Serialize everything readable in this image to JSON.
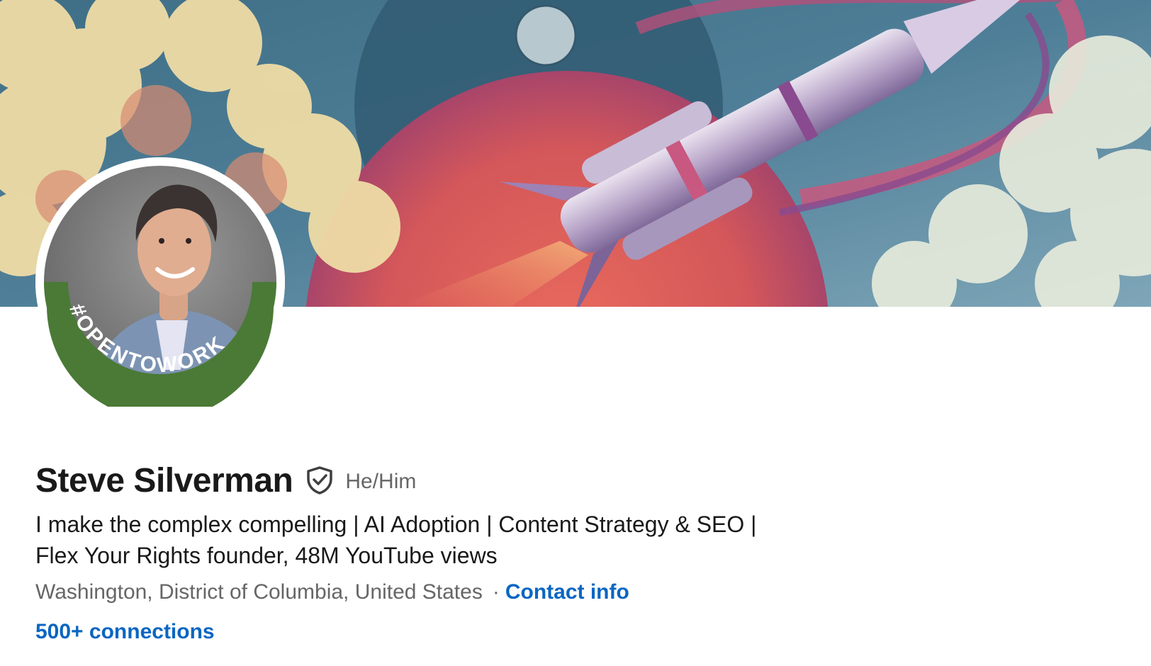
{
  "profile": {
    "name": "Steve Silverman",
    "pronouns": "He/Him",
    "headline": "I make the complex compelling | AI Adoption | Content Strategy & SEO | Flex Your Rights founder, 48M YouTube views",
    "location": "Washington, District of Columbia, United States",
    "separator": "·",
    "contact_info_label": "Contact info",
    "connections_label": "500+ connections",
    "open_to_work_label": "#OPENTOWORK"
  },
  "icons": {
    "verified": "shield-check-icon"
  },
  "colors": {
    "link": "#0a66c2",
    "name_text": "#191919",
    "secondary_text": "#666666",
    "open_to_work_ring": "#4a7a35"
  }
}
